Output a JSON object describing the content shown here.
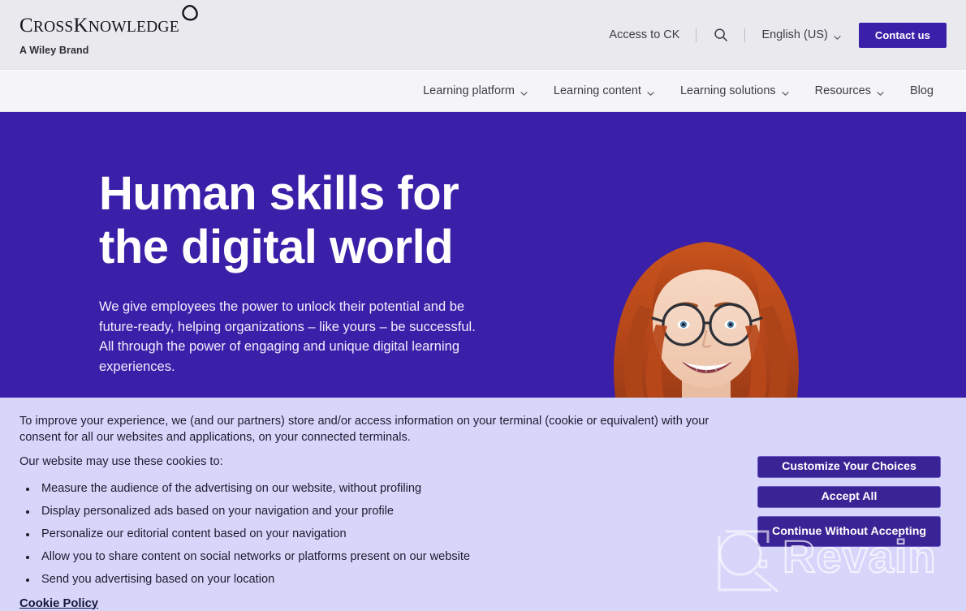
{
  "brand": {
    "wordmark_cross": "C",
    "wordmark_cross_rest": "ROSS",
    "wordmark_k": "K",
    "wordmark_k_rest": "NOWLEDGE",
    "tagline": "A Wiley Brand",
    "mark_icon": "rounded-triangle-icon"
  },
  "utility_nav": {
    "access_link": "Access to CK",
    "search_icon": "search-icon",
    "language": "English (US)",
    "language_chevron_icon": "chevron-down-icon",
    "contact_button": "Contact us"
  },
  "main_nav": {
    "items": [
      {
        "label": "Learning platform",
        "has_chevron": true
      },
      {
        "label": "Learning content",
        "has_chevron": true
      },
      {
        "label": "Learning solutions",
        "has_chevron": true
      },
      {
        "label": "Resources",
        "has_chevron": true
      },
      {
        "label": "Blog",
        "has_chevron": false
      }
    ]
  },
  "hero": {
    "title_line1": "Human skills for",
    "title_line2": "the digital world",
    "body": "We give employees the power to unlock their potential and be future-ready, helping organizations – like yours – be successful. All through the power of engaging and unique digital learning experiences.",
    "image_alt": "smiling-woman-with-glasses-portrait"
  },
  "cookie_banner": {
    "intro_line1": "To improve your experience, we (and our partners) store and/or access information on your terminal (cookie or equivalent) with your consent for all our websites and applications, on your connected terminals.",
    "intro_line2": "Our website may use these cookies to:",
    "bullets": [
      "Measure the audience of the advertising on our website, without profiling",
      "Display personalized ads based on your navigation and your profile",
      "Personalize our editorial content based on your navigation",
      "Allow you to share content on social networks or platforms present on our website",
      "Send you advertising based on your location"
    ],
    "policy_link": "Cookie Policy",
    "buttons": {
      "customize": "Customize Your Choices",
      "accept_all": "Accept All",
      "continue_without": "Continue Without Accepting"
    }
  },
  "watermark": {
    "text": "Revain",
    "logo_icon": "revain-logo-icon"
  },
  "colors": {
    "hero_purple": "#3a20a8",
    "banner_lavender": "#d8d5fb",
    "button_indigo": "#3a2395",
    "header_gray": "#eaeaee",
    "nav_gray": "#f5f5f7"
  }
}
